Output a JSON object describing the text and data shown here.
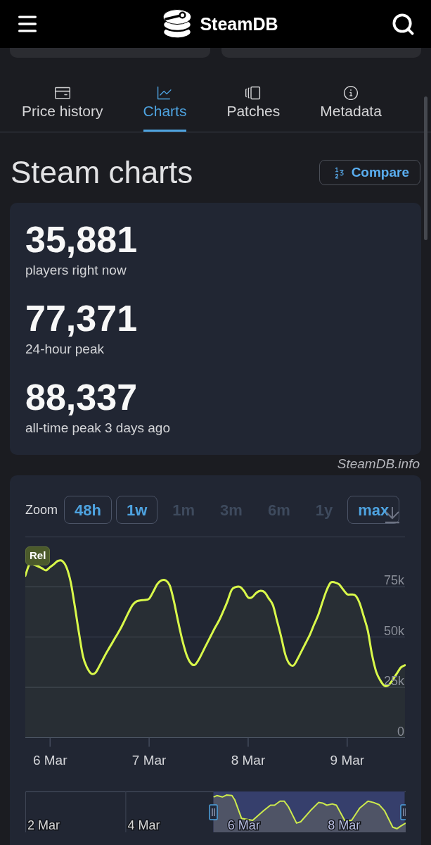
{
  "header": {
    "title": "SteamDB"
  },
  "tabs": [
    {
      "label": "Price history",
      "selected": false
    },
    {
      "label": "Charts",
      "selected": true
    },
    {
      "label": "Patches",
      "selected": false
    },
    {
      "label": "Metadata",
      "selected": false
    }
  ],
  "section": {
    "title": "Steam charts",
    "compare_button": "Compare"
  },
  "stats": [
    {
      "value": "35,881",
      "label": "players right now"
    },
    {
      "value": "77,371",
      "label": "24-hour peak"
    },
    {
      "value": "88,337",
      "label": "all-time peak 3 days ago"
    }
  ],
  "source": "SteamDB.info",
  "chart": {
    "zoom_label": "Zoom",
    "zoom_buttons": [
      {
        "label": "48h",
        "disabled": false
      },
      {
        "label": "1w",
        "disabled": false
      },
      {
        "label": "1m",
        "disabled": true
      },
      {
        "label": "3m",
        "disabled": true
      },
      {
        "label": "6m",
        "disabled": true
      },
      {
        "label": "1y",
        "disabled": true
      },
      {
        "label": "max",
        "disabled": false
      }
    ],
    "chart_data": {
      "type": "area",
      "grid": true,
      "categories": [
        null,
        null,
        null,
        null,
        null,
        null,
        "6 Mar",
        null,
        null,
        null,
        null,
        null,
        null,
        null,
        null,
        null,
        null,
        null,
        null,
        null,
        null,
        null,
        null,
        null,
        null,
        null,
        null,
        null,
        null,
        null,
        "7 Mar",
        null,
        null,
        null,
        null,
        null,
        null,
        null,
        null,
        null,
        null,
        null,
        null,
        null,
        null,
        null,
        null,
        null,
        null,
        null,
        null,
        null,
        null,
        null,
        "8 Mar",
        null,
        null,
        null,
        null,
        null,
        null,
        null,
        null,
        null,
        null,
        null,
        null,
        null,
        null,
        null,
        null,
        null,
        null,
        null,
        null,
        null,
        null,
        null,
        "9 Mar",
        null,
        null,
        null,
        null,
        null,
        null,
        null,
        null,
        null,
        null,
        null,
        null,
        null,
        null
      ],
      "series": [
        {
          "color": "#d9f94a",
          "values": [
            80500,
            86200,
            86100,
            85300,
            84300,
            83200,
            84800,
            86400,
            88000,
            87800,
            84600,
            77300,
            65300,
            52100,
            40200,
            34700,
            31800,
            32300,
            35800,
            39700,
            43400,
            46900,
            50400,
            53900,
            58000,
            62200,
            66000,
            67800,
            68300,
            68500,
            69100,
            72600,
            76400,
            78200,
            78200,
            75700,
            67900,
            58000,
            48900,
            41600,
            37300,
            36100,
            38700,
            42700,
            46800,
            50800,
            54800,
            58500,
            63000,
            67900,
            73500,
            74900,
            75000,
            72900,
            69700,
            69900,
            72100,
            73000,
            72300,
            69200,
            65900,
            58100,
            50100,
            41300,
            36700,
            35900,
            39200,
            43300,
            47300,
            51400,
            56400,
            61100,
            67400,
            73200,
            77100,
            77200,
            76300,
            73700,
            71300,
            71200,
            70700,
            67000,
            60300,
            53100,
            41400,
            32900,
            28500,
            25800,
            26100,
            28700,
            31800,
            34900,
            36000
          ]
        }
      ],
      "ylim": [
        0,
        100000
      ],
      "yticks": [
        {
          "value": 0,
          "label": "0"
        },
        {
          "value": 25000,
          "label": "25k"
        },
        {
          "value": 50000,
          "label": "50k"
        },
        {
          "value": 75000,
          "label": "75k"
        }
      ],
      "annotations": [
        "Rel"
      ]
    },
    "navigator": {
      "labels": [
        "2 Mar",
        "4 Mar",
        "6 Mar",
        "8 Mar"
      ]
    }
  }
}
